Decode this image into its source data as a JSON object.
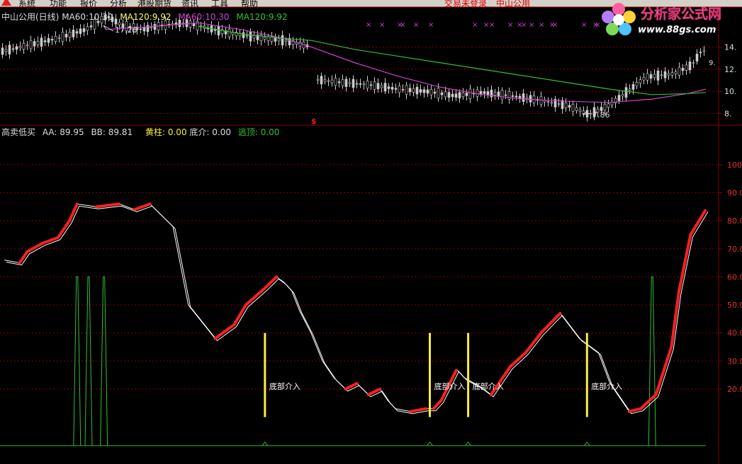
{
  "menubar": {
    "items": [
      "系统",
      "功能",
      "报价",
      "分析",
      "港股期货",
      "资讯",
      "工具",
      "帮助"
    ],
    "status_text": "交易未登录",
    "stock_text": "中山公用"
  },
  "watermark": {
    "title": "分析家公式网",
    "url": "www.88gs.com"
  },
  "price_panel": {
    "header": {
      "name": "中山公用(日线)",
      "ma60_label": "MA60:",
      "ma60_value": "10.30",
      "ma120_label": "MA120:",
      "ma120_value": "9.92",
      "ma60_label2": "MA60:",
      "ma60_value2": "10.30",
      "ma120_label2": "MA120:",
      "ma120_value2": "9.92"
    },
    "high_marker": "17.26",
    "low_marker": "7.86",
    "s_marker": "$",
    "right_partial_label": "9.",
    "y_ticks": [
      "14.",
      "12.",
      "10.",
      "8."
    ],
    "colors": {
      "ma60": "#d040d0",
      "ma120": "#30c030",
      "candle": "#dddddd",
      "x_marker": "#d040d0",
      "s_marker": "#e02020"
    }
  },
  "indicator_panel": {
    "header": {
      "name": "高卖低买",
      "aa_label": "AA:",
      "aa_value": "89.95",
      "bb_label": "BB:",
      "bb_value": "89.81",
      "yellow_label": "黄柱:",
      "yellow_value": "0.00",
      "bottom_label": "底介:",
      "bottom_value": "0.00",
      "escape_label": "逃顶:",
      "escape_value": "0.00"
    },
    "y_ticks": [
      "100",
      "90.0",
      "80.0",
      "70.0",
      "60.0",
      "50.0",
      "40.0",
      "30.0",
      "20.0"
    ],
    "annotation": "底部介入",
    "colors": {
      "aa": "#ffffff",
      "rising": "#ff2020",
      "yellow": "#ffee40",
      "escape": "#30c030",
      "grid": "#8b0000"
    }
  },
  "chart_data": [
    {
      "type": "line",
      "title": "中山公用(日线)",
      "series": [
        {
          "name": "MA60"
        },
        {
          "name": "MA120"
        }
      ],
      "ylim": [
        7,
        17.5
      ],
      "annotations": [
        "17.26",
        "7.86"
      ],
      "values_note": ""
    },
    {
      "type": "line",
      "title": "高卖低买",
      "ylim": [
        0,
        105
      ],
      "series": [
        {
          "name": "AA",
          "x": [
            0,
            4,
            6,
            10,
            14,
            17,
            19,
            24,
            30,
            34,
            38,
            44,
            48,
            55,
            60,
            63,
            68,
            71,
            73,
            75,
            77,
            80,
            83,
            86,
            89,
            92,
            95,
            98,
            100,
            102,
            106,
            110,
            112,
            114,
            118,
            120,
            124,
            127,
            132,
            136,
            140,
            145,
            150,
            155,
            158,
            163,
            166,
            170,
            174,
            176,
            179,
            183
          ],
          "values": [
            66,
            65,
            69,
            72,
            74,
            80,
            86,
            85,
            86,
            84,
            86,
            78,
            50,
            38,
            43,
            50,
            56,
            60,
            58,
            55,
            48,
            40,
            30,
            24,
            20,
            22,
            18,
            20,
            16,
            13,
            12,
            13,
            13,
            16,
            27,
            24,
            21,
            18,
            28,
            33,
            40,
            47,
            38,
            33,
            22,
            12,
            13,
            18,
            35,
            55,
            75,
            84
          ]
        },
        {
          "name": "BB"
        }
      ],
      "yellow_bars_x": [
        68,
        111,
        121,
        152
      ],
      "escape_spikes_x": [
        19,
        22,
        26,
        169
      ],
      "annotations": [
        "底部介入",
        "底部介入",
        "底部介入",
        "底部介入"
      ],
      "grid": true
    }
  ]
}
